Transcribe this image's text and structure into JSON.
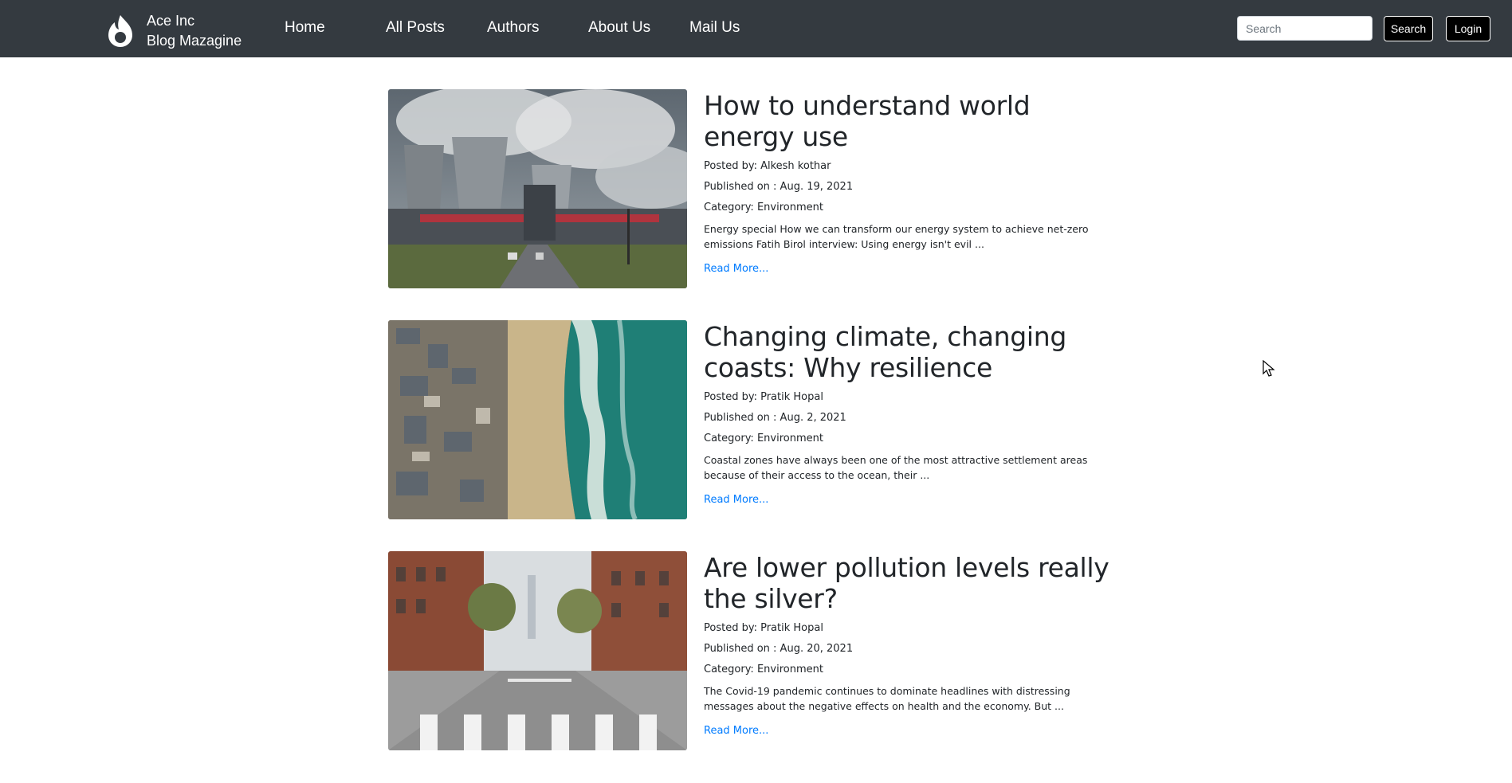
{
  "brand": {
    "line1": "Ace Inc",
    "line2": "Blog Mazagine"
  },
  "nav": {
    "home": "Home",
    "all_posts": "All Posts",
    "authors": "Authors",
    "about": "About Us",
    "mail": "Mail Us"
  },
  "search": {
    "placeholder": "Search",
    "value": "",
    "button": "Search"
  },
  "login": "Login",
  "posts": [
    {
      "title": "How to understand world energy use",
      "author": "Posted by: Alkesh kothar",
      "published": "Published on : Aug. 19, 2021",
      "category": "Category: Environment",
      "excerpt": "Energy special How we can transform our energy system to achieve net-zero emissions Fatih Birol interview: Using energy isn't evil ...",
      "read_more": "Read More..."
    },
    {
      "title": "Changing climate, changing coasts: Why resilience",
      "author": "Posted by: Pratik Hopal",
      "published": "Published on : Aug. 2, 2021",
      "category": "Category: Environment",
      "excerpt": "Coastal zones have always been one of the most attractive settlement areas because of their access to the ocean, their ...",
      "read_more": "Read More..."
    },
    {
      "title": "Are lower pollution levels really the silver?",
      "author": "Posted by: Pratik Hopal",
      "published": "Published on : Aug. 20, 2021",
      "category": "Category: Environment",
      "excerpt": "The Covid-19 pandemic continues to dominate headlines with distressing messages about the negative effects on health and the economy. But ...",
      "read_more": "Read More..."
    }
  ],
  "colors": {
    "navbar": "#343a40",
    "link": "#007bff",
    "text": "#212529"
  }
}
